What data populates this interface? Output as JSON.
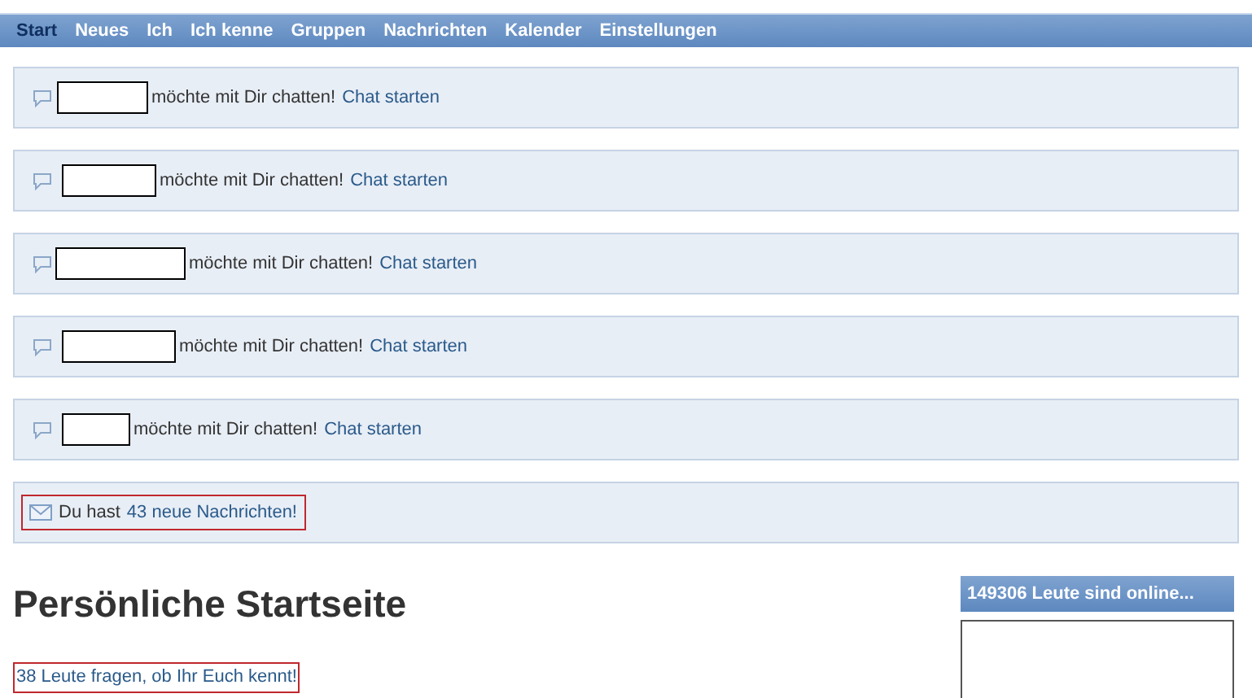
{
  "nav": [
    {
      "label": "Start",
      "selected": true
    },
    {
      "label": "Neues",
      "selected": false
    },
    {
      "label": "Ich",
      "selected": false
    },
    {
      "label": "Ich kenne",
      "selected": false
    },
    {
      "label": "Gruppen",
      "selected": false
    },
    {
      "label": "Nachrichten",
      "selected": false
    },
    {
      "label": "Kalender",
      "selected": false
    },
    {
      "label": "Einstellungen",
      "selected": false
    }
  ],
  "chat_requests": [
    {
      "text": "möchte mit Dir chatten!",
      "link": "Chat starten"
    },
    {
      "text": "möchte mit Dir chatten!",
      "link": "Chat starten"
    },
    {
      "text": "möchte mit Dir chatten!",
      "link": "Chat starten"
    },
    {
      "text": "möchte mit Dir chatten!",
      "link": "Chat starten"
    },
    {
      "text": "möchte mit Dir chatten!",
      "link": "Chat starten"
    }
  ],
  "messages_notice": {
    "text": "Du hast",
    "link": "43 neue Nachrichten!"
  },
  "heading": "Persönliche Startseite",
  "acquaintance_link": "38 Leute fragen, ob Ihr Euch kennt!",
  "online_box": {
    "title": "149306 Leute sind online..."
  }
}
